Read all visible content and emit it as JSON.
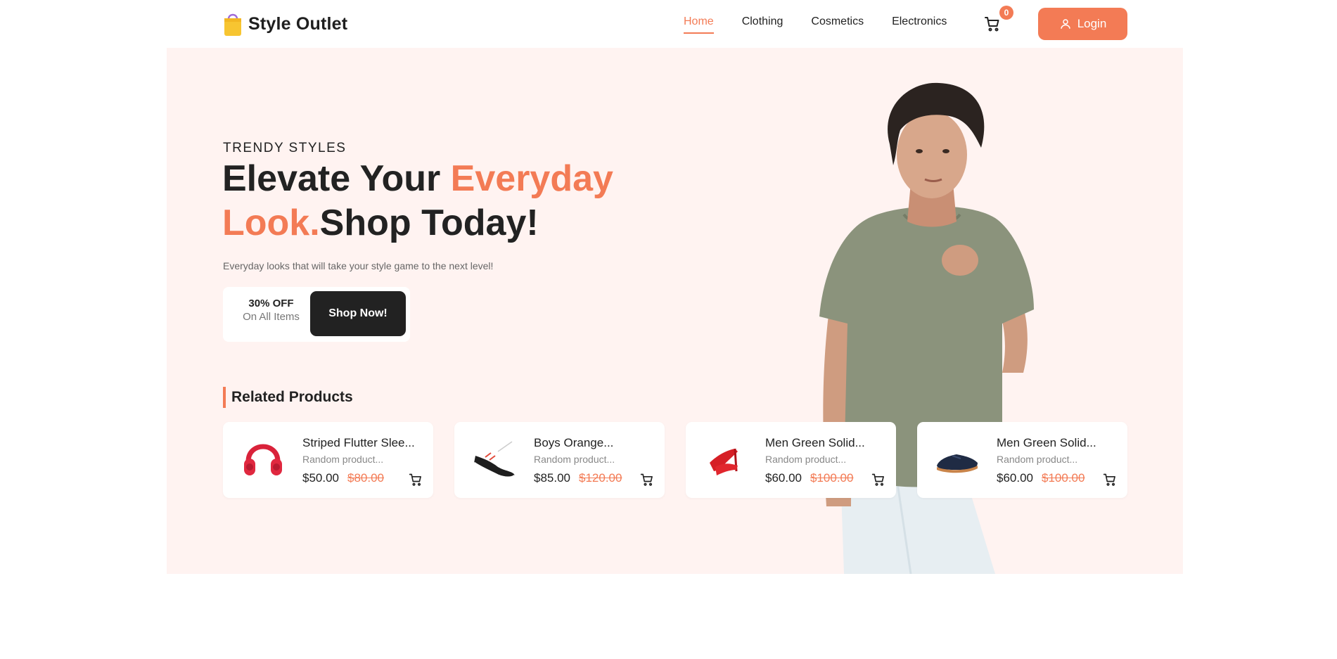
{
  "brand": {
    "name": "Style Outlet",
    "icon": "shopping-bag-icon"
  },
  "nav": {
    "items": [
      {
        "label": "Home",
        "active": true
      },
      {
        "label": "Clothing",
        "active": false
      },
      {
        "label": "Cosmetics",
        "active": false
      },
      {
        "label": "Electronics",
        "active": false
      }
    ],
    "cart_count": "0",
    "login_label": "Login"
  },
  "hero": {
    "eyebrow": "TRENDY STYLES",
    "headline_part1": "Elevate Your ",
    "headline_accent": "Everyday Look.",
    "headline_part2": "Shop Today!",
    "subtitle": "Everyday looks that will take your style game to the next level!",
    "offer_title": "30% OFF",
    "offer_sub": "On All Items",
    "shop_button": "Shop Now!"
  },
  "related": {
    "title": "Related Products",
    "products": [
      {
        "name": "Striped Flutter Slee...",
        "desc": "Random product...",
        "price": "$50.00",
        "old_price": "$80.00",
        "image": "red-headphones"
      },
      {
        "name": "Boys Orange...",
        "desc": "Random product...",
        "price": "$85.00",
        "old_price": "$120.00",
        "image": "black-sneaker"
      },
      {
        "name": "Men Green Solid...",
        "desc": "Random product...",
        "price": "$60.00",
        "old_price": "$100.00",
        "image": "red-heels"
      },
      {
        "name": "Men Green Solid...",
        "desc": "Random product...",
        "price": "$60.00",
        "old_price": "$100.00",
        "image": "navy-shoe"
      }
    ]
  },
  "colors": {
    "accent": "#f37b55",
    "dark": "#222222",
    "hero_bg": "#fff3f1"
  }
}
